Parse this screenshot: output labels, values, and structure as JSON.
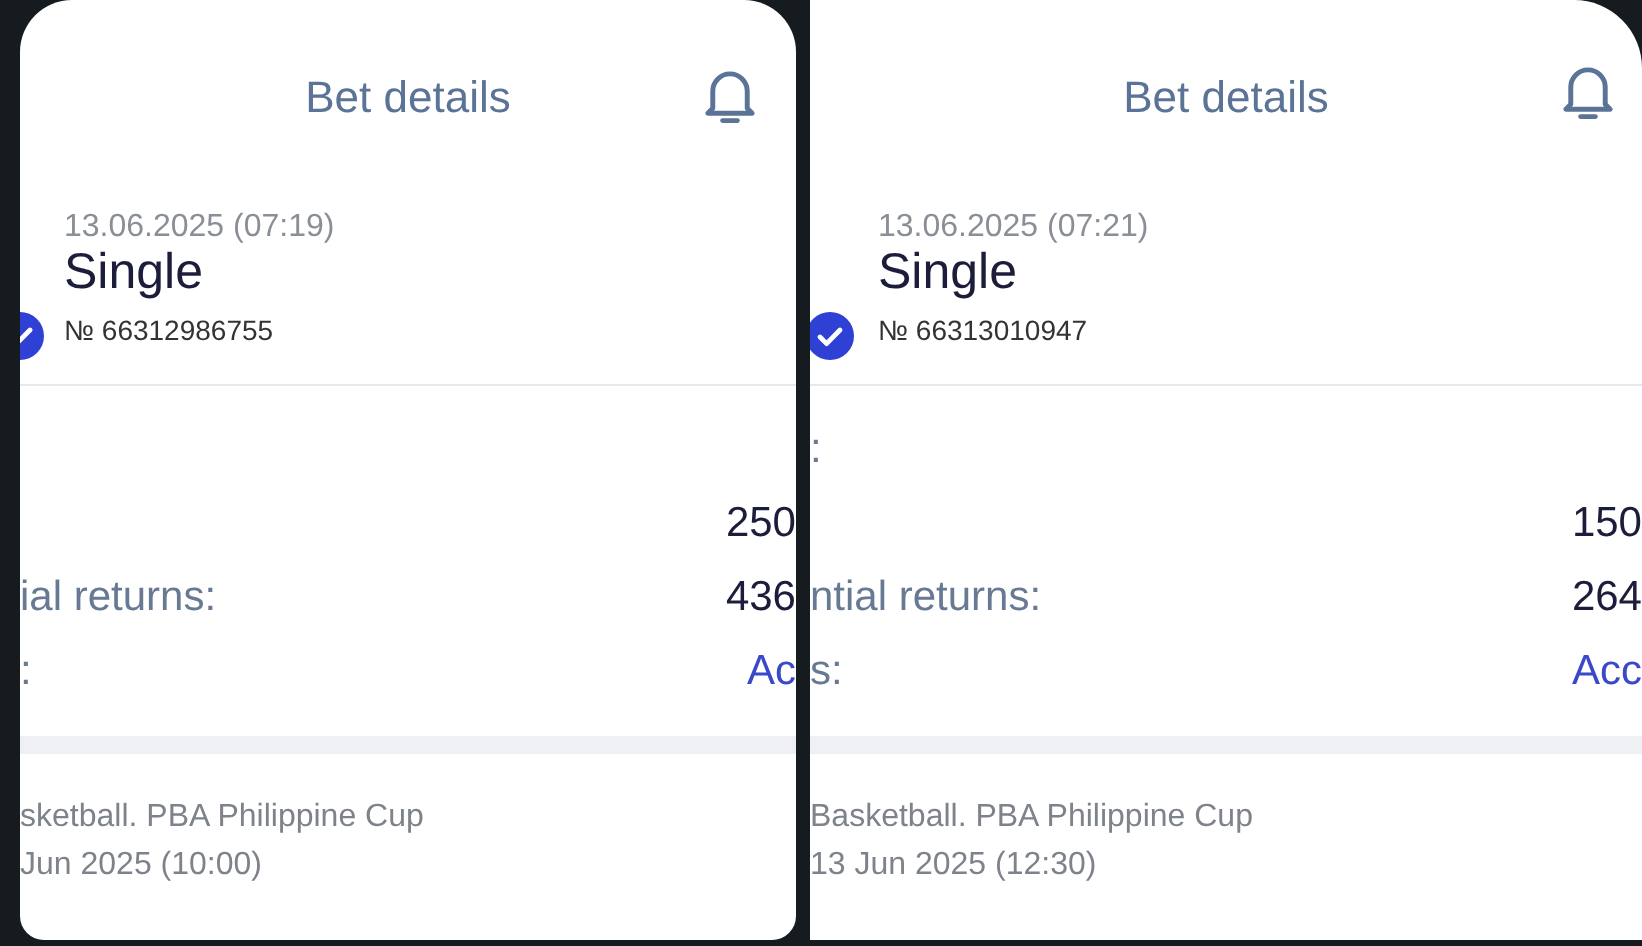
{
  "screens": [
    {
      "title": "Bet details",
      "date": "13.06.2025 (07:19)",
      "bet_type": "Single",
      "number": "№ 66312986755",
      "checked": true,
      "rows": [
        {
          "value": "250"
        },
        {
          "label": "ial returns:",
          "value": "436"
        },
        {
          "label": ":",
          "value": "Ac",
          "kind": "link"
        }
      ],
      "event": {
        "league": "sketball. PBA Philippine Cup",
        "time": "Jun 2025 (10:00)"
      }
    },
    {
      "title": "Bet details",
      "date": "13.06.2025 (07:21)",
      "bet_type": "Single",
      "number": "№ 66313010947",
      "checked": true,
      "rows": [
        {
          "label": ":"
        },
        {
          "value": "150"
        },
        {
          "label": "ntial returns:",
          "value": "264"
        },
        {
          "label": "s:",
          "value": "Acc",
          "kind": "link"
        }
      ],
      "event": {
        "league": "Basketball. PBA Philippine Cup",
        "time": "13 Jun 2025 (12:30)"
      }
    }
  ]
}
